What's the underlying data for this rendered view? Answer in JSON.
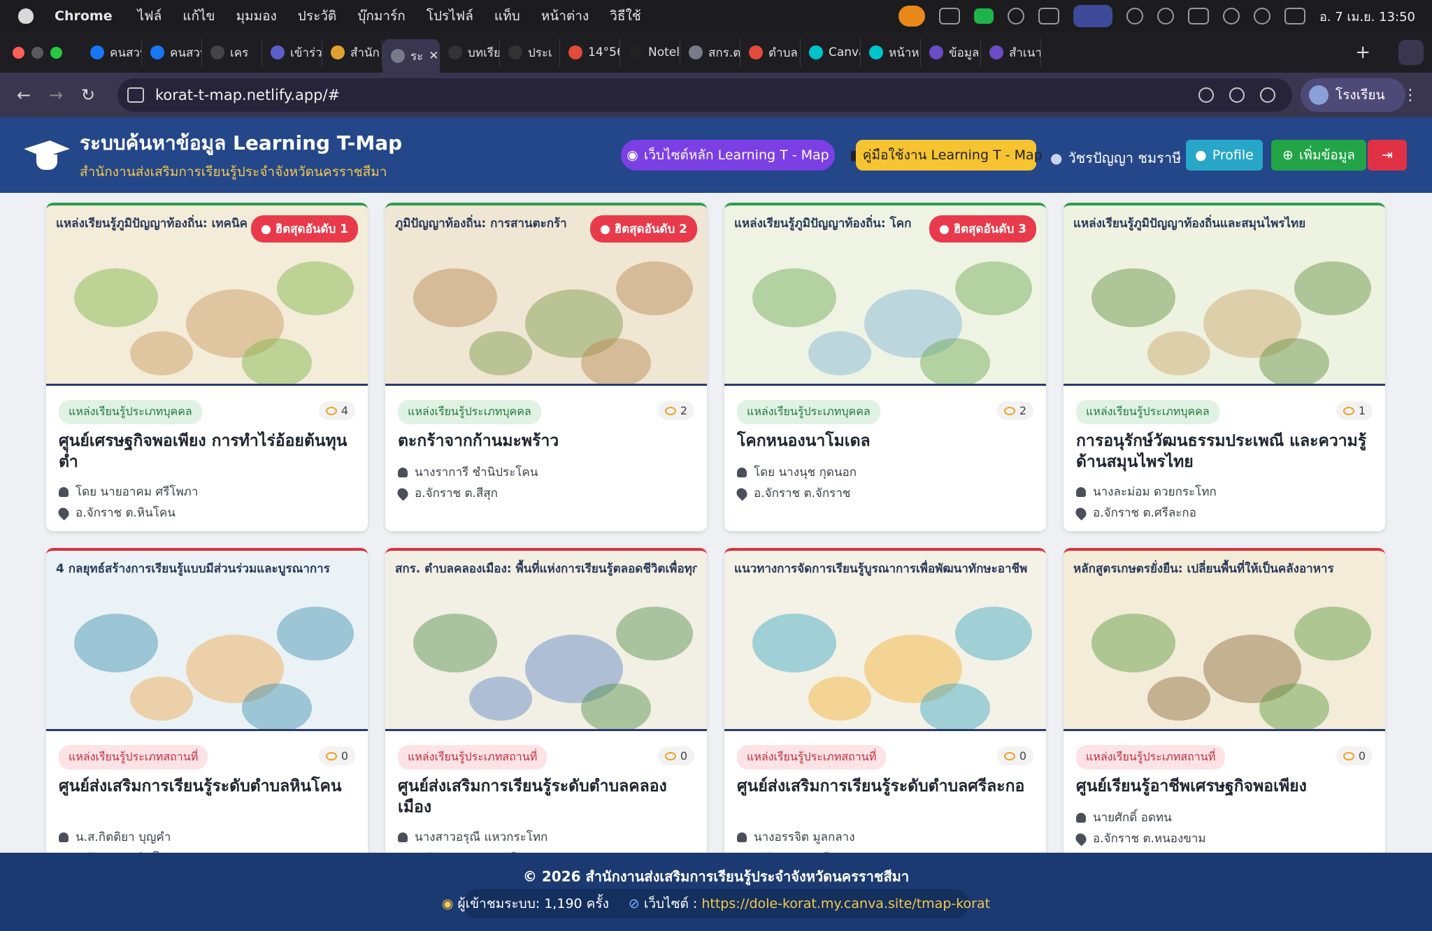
{
  "menubar": {
    "app": "Chrome",
    "menus": [
      "ไฟล์",
      "แก้ไข",
      "มุมมอง",
      "ประวัติ",
      "บุ๊กมาร์ก",
      "โปรไฟล์",
      "แท็บ",
      "หน้าต่าง",
      "วิธีใช้"
    ],
    "clock": "อ. 7 เม.ย. 13:50"
  },
  "tabs": [
    {
      "label": "คนสวน",
      "icon": "facebook-icon",
      "color": "#1877f2"
    },
    {
      "label": "คนสวน",
      "icon": "facebook-icon",
      "color": "#1877f2"
    },
    {
      "label": "เคร",
      "icon": "help-icon",
      "color": "#444"
    },
    {
      "label": "เข้าร่วม",
      "icon": "teams-icon",
      "color": "#5b5fc7"
    },
    {
      "label": "สำนัก",
      "icon": "dole-icon",
      "color": "#e0a030"
    },
    {
      "label": "ระ",
      "icon": "globe-icon",
      "color": "#7a7a8a",
      "active": true
    },
    {
      "label": "บทเรีย",
      "icon": "notion-icon",
      "color": "#333"
    },
    {
      "label": "ประเ",
      "icon": "notion-icon",
      "color": "#333"
    },
    {
      "label": "14°56",
      "icon": "map-pin-icon",
      "color": "#e24a3b"
    },
    {
      "label": "Notel",
      "icon": "notebooklm-icon",
      "color": "#222"
    },
    {
      "label": "สกร.ต",
      "icon": "globe-icon",
      "color": "#7a7a8a"
    },
    {
      "label": "ตำบล",
      "icon": "map-pin-icon",
      "color": "#e24a3b"
    },
    {
      "label": "Canva",
      "icon": "canva-icon",
      "color": "#00c4cc"
    },
    {
      "label": "หน้าห",
      "icon": "canva-icon",
      "color": "#00c4cc"
    },
    {
      "label": "ข้อมูล",
      "icon": "forms-icon",
      "color": "#6a4cc7"
    },
    {
      "label": "สำเนา",
      "icon": "forms-icon",
      "color": "#6a4cc7"
    }
  ],
  "address": {
    "url": "korat-t-map.netlify.app/#",
    "profile": "โรงเรียน"
  },
  "header": {
    "title": "ระบบค้นหาข้อมูล Learning T-Map",
    "subtitle": "สำนักงานส่งเสริมการเรียนรู้ประจำจังหวัดนครราชสีมา",
    "main_site": "เว็บไซต์หลัก Learning T - Map",
    "manual": "คู่มือใช้งาน Learning T - Map",
    "user": "วัชรปัญญา ชมราษี",
    "profile": "Profile",
    "add": "เพิ่มข้อมูล"
  },
  "cards": [
    {
      "thumb_title": "แหล่งเรียนรู้ภูมิปัญญาท้องถิ่น: เทคนิค",
      "hot": "ฮิตสุดอันดับ 1",
      "tag": "แหล่งเรียนรู้ประเภทบุคคล",
      "views": "4",
      "name": "ศูนย์เศรษฐกิจพอเพียง การทำไร่อ้อยต้นทุนต่ำ",
      "person": "โดย นายอาคม ศรีโพภา",
      "place": "อ.จักราช ต.หินโคน"
    },
    {
      "thumb_title": "ภูมิปัญญาท้องถิ่น: การสานตะกร้า",
      "hot": "ฮิตสุดอันดับ 2",
      "tag": "แหล่งเรียนรู้ประเภทบุคคล",
      "views": "2",
      "name": "ตะกร้าจากก้านมะพร้าว",
      "person": "นางราการี ชำนิประโคน",
      "place": "อ.จักราช ต.สีสุก"
    },
    {
      "thumb_title": "แหล่งเรียนรู้ภูมิปัญญาท้องถิ่น: โคก",
      "hot": "ฮิตสุดอันดับ 3",
      "tag": "แหล่งเรียนรู้ประเภทบุคคล",
      "views": "2",
      "name": "โคกหนองนาโมเดล",
      "person": "โดย นางนุช กุดนอก",
      "place": "อ.จักราช ต.จักราช"
    },
    {
      "thumb_title": "แหล่งเรียนรู้ภูมิปัญญาท้องถิ่นและสมุนไพรไทย",
      "hot": "",
      "tag": "แหล่งเรียนรู้ประเภทบุคคล",
      "views": "1",
      "name": "การอนุรักษ์วัฒนธรรมประเพณี และความรู้ด้านสมุนไพรไทย",
      "person": "นางละม่อม ดวยกระโทก",
      "place": "อ.จักราช ต.ศรีละกอ"
    },
    {
      "thumb_title": "4 กลยุทธ์สร้างการเรียนรู้แบบมีส่วนร่วมและบูรณาการ",
      "hot": "",
      "tag": "แหล่งเรียนรู้ประเภทสถานที่",
      "views": "0",
      "name": "ศูนย์ส่งเสริมการเรียนรู้ระดับตำบลหินโคน",
      "person": "น.ส.กิตติยา บุญคำ",
      "place": "อ.จักราช ต.หินโคน"
    },
    {
      "thumb_title": "สกร. ตำบลคลองเมือง: พื้นที่แห่งการเรียนรู้ตลอดชีวิตเพื่อทุกคน",
      "hot": "",
      "tag": "แหล่งเรียนรู้ประเภทสถานที่",
      "views": "0",
      "name": "ศูนย์ส่งเสริมการเรียนรู้ระดับตำบลคลองเมือง",
      "person": "นางสาวอรุณี แหวกระโทก",
      "place": "อ.จักราช ต.คลองเมือง"
    },
    {
      "thumb_title": "แนวทางการจัดการเรียนรู้บูรณาการเพื่อพัฒนาทักษะอาชีพ",
      "hot": "",
      "tag": "แหล่งเรียนรู้ประเภทสถานที่",
      "views": "0",
      "name": "ศูนย์ส่งเสริมการเรียนรู้ระดับตำบลศรีละกอ",
      "person": "นางอรรจิต มูลกลาง",
      "place": "อ.จักราช ต.ศรีละกอ"
    },
    {
      "thumb_title": "หลักสูตรเกษตรยั่งยืน: เปลี่ยนพื้นที่ให้เป็นคลังอาหาร",
      "hot": "",
      "tag": "แหล่งเรียนรู้ประเภทสถานที่",
      "views": "0",
      "name": "ศูนย์เรียนรู้อาชีพเศรษฐกิจพอเพียง",
      "person": "นายศักดิ์ อดทน",
      "place": "อ.จักราช ต.หนองขาม"
    }
  ],
  "footer": {
    "copyright": "© 2026 สำนักงานส่งเสริมการเรียนรู้ประจำจังหวัดนครราชสีมา",
    "visitors": "ผู้เข้าชมระบบ: 1,190 ครั้ง",
    "website_label": "เว็บไซต์ :",
    "website_url": "https://dole-korat.my.canva.site/tmap-korat"
  }
}
